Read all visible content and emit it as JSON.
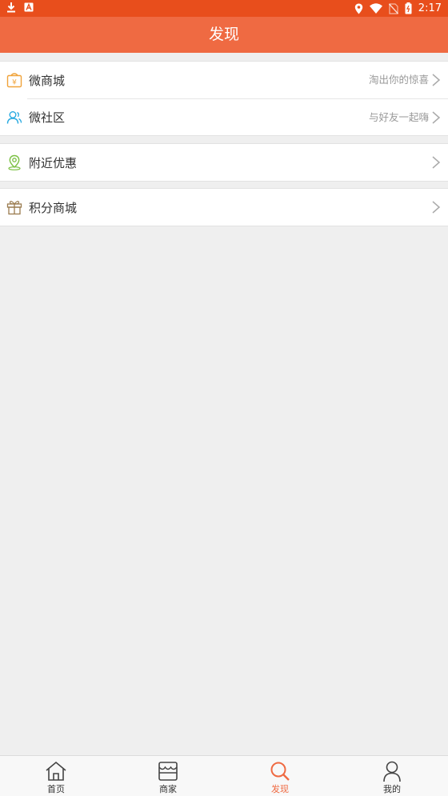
{
  "status_bar": {
    "time": "2:17"
  },
  "header": {
    "title": "发现"
  },
  "groups": [
    {
      "items": [
        {
          "label": "微商城",
          "hint": "淘出你的惊喜",
          "icon": "shop-bag-icon"
        },
        {
          "label": "微社区",
          "hint": "与好友一起嗨",
          "icon": "users-icon"
        }
      ]
    },
    {
      "items": [
        {
          "label": "附近优惠",
          "hint": "",
          "icon": "location-icon"
        }
      ]
    },
    {
      "items": [
        {
          "label": "积分商城",
          "hint": "",
          "icon": "gift-icon"
        }
      ]
    }
  ],
  "tabs": [
    {
      "label": "首页",
      "icon": "home-icon"
    },
    {
      "label": "商家",
      "icon": "store-icon"
    },
    {
      "label": "发现",
      "icon": "search-icon",
      "active": true
    },
    {
      "label": "我的",
      "icon": "profile-icon"
    }
  ],
  "colors": {
    "status_bar": "#e84e1c",
    "header": "#ef6a42",
    "active_tab": "#ef6a42"
  }
}
